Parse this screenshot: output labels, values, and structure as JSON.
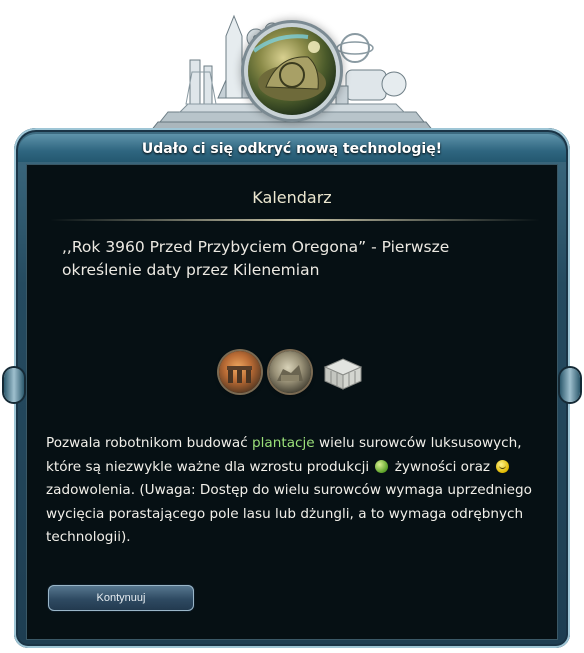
{
  "dialog": {
    "title": "Udało ci się odkryć nową technologię!",
    "tech_name": "Kalendarz",
    "quote": ",,Rok 3960 Przed Przybyciem Oregona” - Pierwsze określenie daty przez Kilenemian",
    "unlock_icons": [
      "stonehenge-icon",
      "ruins-icon",
      "building-icon"
    ],
    "description": {
      "part1": "Pozwala robotnikom budować ",
      "highlight": "plantacje",
      "part2": " wielu surowców luksusowych, które są niezwykle ważne dla wzrostu produkcji ",
      "part3": " żywności oraz ",
      "part4": " zadowolenia. (Uwaga: Dostęp do wielu surowców wymaga uprzedniego wycięcia porastającego pole lasu lub dżungli, a to wymaga odrębnych technologii)."
    },
    "continue_label": "Kontynuuj"
  },
  "colors": {
    "frame": "#2f6680",
    "inner": "#061014",
    "highlight": "#9be07a",
    "text": "#f2f0ea"
  }
}
